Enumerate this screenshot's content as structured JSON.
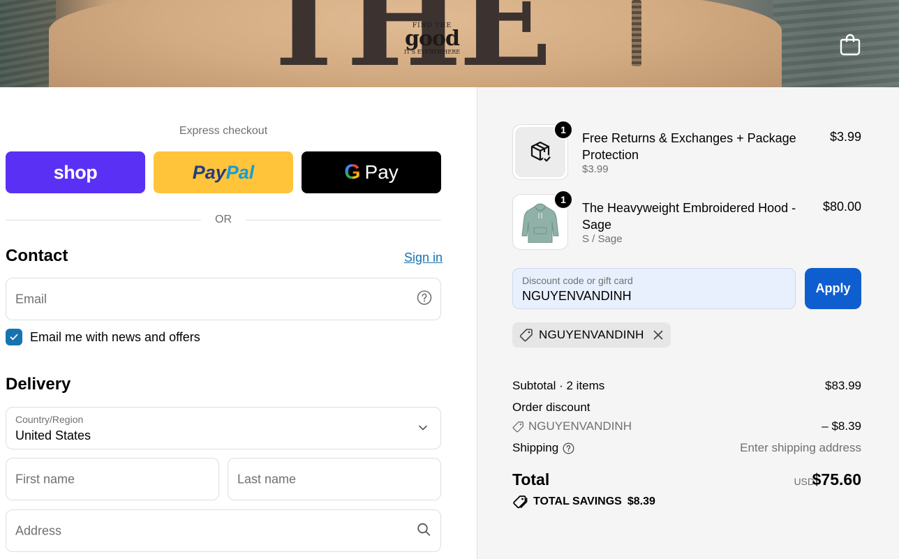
{
  "header": {
    "banner_text": "THE",
    "logo": {
      "top": "FIND THE",
      "mid": "good",
      "bottom": "IT'S EVERYWHERE"
    },
    "cart_icon": "shopping-bag-icon"
  },
  "express": {
    "label": "Express checkout",
    "shop_label": "shop",
    "paypal_part1": "Pay",
    "paypal_part2": "Pal",
    "gpay_g": "G",
    "gpay_label": "Pay",
    "or_label": "OR"
  },
  "contact": {
    "title": "Contact",
    "signin_label": "Sign in",
    "email_placeholder": "Email",
    "newsletter_label": "Email me with news and offers",
    "newsletter_checked": true
  },
  "delivery": {
    "title": "Delivery",
    "country_label": "Country/Region",
    "country_value": "United States",
    "first_name_placeholder": "First name",
    "last_name_placeholder": "Last name",
    "address_placeholder": "Address"
  },
  "order": {
    "items": [
      {
        "quantity": "1",
        "name": "Free Returns & Exchanges + Package Protection",
        "sub": "$3.99",
        "price": "$3.99",
        "icon": "package-check-icon"
      },
      {
        "quantity": "1",
        "name": "The Heavyweight Embroidered Hood - Sage",
        "sub": "S / Sage",
        "price": "$80.00",
        "icon": "hoodie-image"
      }
    ],
    "discount_label": "Discount code or gift card",
    "discount_value": "NGUYENVANDINH",
    "apply_label": "Apply",
    "applied_code": "NGUYENVANDINH",
    "subtotal_label": "Subtotal · 2 items",
    "subtotal_value": "$83.99",
    "order_discount_label": "Order discount",
    "order_discount_code": "NGUYENVANDINH",
    "order_discount_value": "– $8.39",
    "shipping_label": "Shipping",
    "shipping_value": "Enter shipping address",
    "total_label": "Total",
    "total_currency": "USD",
    "total_value": "$75.60",
    "savings_label": "TOTAL SAVINGS",
    "savings_value": "$8.39"
  },
  "colors": {
    "shop": "#5a31f4",
    "paypal": "#ffc439",
    "apply": "#0f5ecf",
    "link": "#1773b0"
  }
}
